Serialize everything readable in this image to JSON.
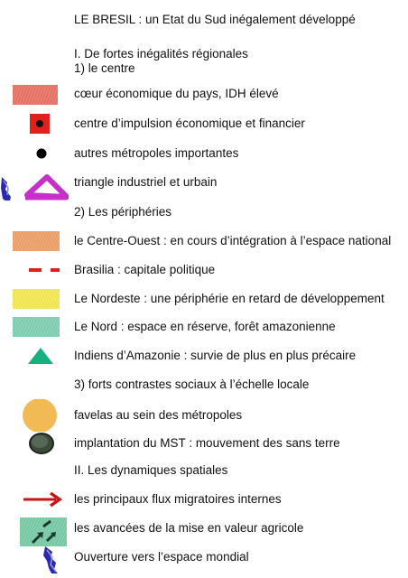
{
  "title": "LE BRESIL : un Etat du Sud inégalement développé",
  "section1": {
    "heading": "I. De fortes inégalités régionales",
    "subheading": "1) le centre"
  },
  "items": [
    {
      "label": "cœur économique du pays, IDH élevé",
      "symbol": "red-hatched-area",
      "color": "#e87f70"
    },
    {
      "label": "centre d’impulsion économique et financier",
      "symbol": "red-square-black-dot",
      "color": "#e0201c"
    },
    {
      "label": "autres métropoles importantes",
      "symbol": "black-dot",
      "color": "#000000"
    },
    {
      "label": "triangle industriel et urbain",
      "symbol": "magenta-triangle",
      "color": "#c530c8"
    },
    {
      "label": "2) Les périphéries",
      "symbol": "none"
    },
    {
      "label": "le Centre-Ouest : en cours d’intégration à l’espace national",
      "symbol": "orange-hatched-area",
      "color": "#eda874"
    },
    {
      "label": "Brasilia : capitale politique",
      "symbol": "red-dashed-line",
      "color": "#e0201c"
    },
    {
      "label": "Le Nordeste : une périphérie en retard de développement",
      "symbol": "yellow-hatched-area",
      "color": "#f3ea62"
    },
    {
      "label": "Le Nord : espace en réserve, forêt amazonienne",
      "symbol": "green-hatched-area",
      "color": "#8dd2ba"
    },
    {
      "label": "Indiens d’Amazonie : survie de plus en plus précaire",
      "symbol": "green-triangle",
      "color": "#17b07f"
    },
    {
      "label": "3) forts contrastes sociaux à l’échelle locale",
      "symbol": "none"
    },
    {
      "label": "favelas au sein des métropoles",
      "symbol": "orange-circle",
      "color": "#f2ba55"
    },
    {
      "label": "implantation du MST : mouvement des sans terre",
      "symbol": "dark-green-blob",
      "color": "#3c4a3c"
    },
    {
      "label": "II. Les dynamiques spatiales",
      "symbol": "none"
    },
    {
      "label": "les principaux flux migratoires internes",
      "symbol": "red-arrow",
      "color": "#c81414"
    },
    {
      "label": "les avancées de la mise en valeur agricole",
      "symbol": "green-area-dark-arrows",
      "color": "#86cfae"
    },
    {
      "label": "Ouverture vers l’espace mondial",
      "symbol": "blue-coastal-arrows",
      "color": "#2a2ab0"
    }
  ]
}
